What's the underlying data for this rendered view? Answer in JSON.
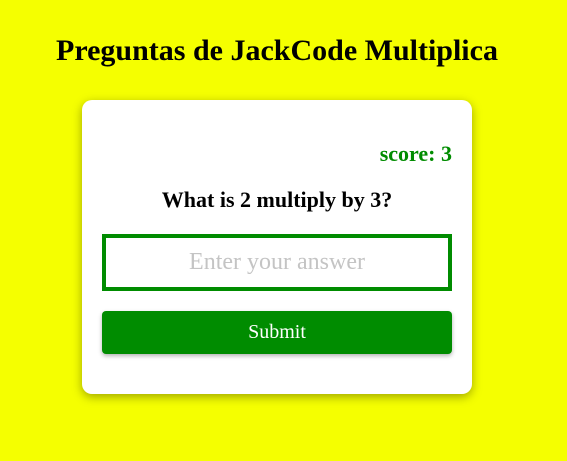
{
  "header": {
    "title": "Preguntas de JackCode Multiplica"
  },
  "quiz": {
    "score_text": "score: 3",
    "question": "What is 2 multiply by 3?",
    "answer": {
      "value": "",
      "placeholder": "Enter your answer"
    },
    "submit_label": "Submit"
  },
  "colors": {
    "background": "#f5ff00",
    "accent": "#008c00",
    "card": "#ffffff"
  }
}
